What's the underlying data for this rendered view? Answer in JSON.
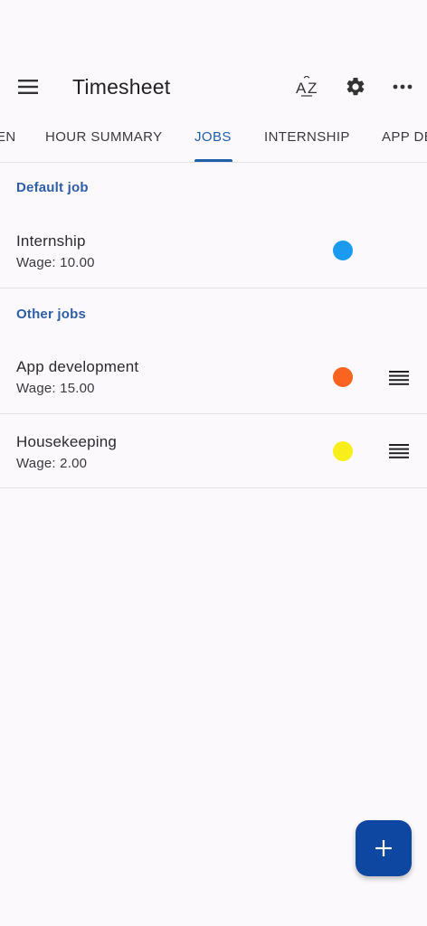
{
  "app_bar": {
    "title": "Timesheet",
    "icons": [
      "menu-icon",
      "sort-az-icon",
      "gear-icon",
      "more-horizontal-icon"
    ]
  },
  "tabs": [
    {
      "label": "EN",
      "active": false
    },
    {
      "label": "HOUR SUMMARY",
      "active": false
    },
    {
      "label": "JOBS",
      "active": true
    },
    {
      "label": "INTERNSHIP",
      "active": false
    },
    {
      "label": "APP DE",
      "active": false
    }
  ],
  "sections": {
    "default": {
      "header": "Default job",
      "jobs": [
        {
          "name": "Internship",
          "wage_label": "Wage: ",
          "wage": "10.00",
          "color": "#1a9bf0"
        }
      ]
    },
    "other": {
      "header": "Other jobs",
      "jobs": [
        {
          "name": "App development",
          "wage_label": "Wage: ",
          "wage": "15.00",
          "color": "#fb6420"
        },
        {
          "name": "Housekeeping",
          "wage_label": "Wage: ",
          "wage": "2.00",
          "color": "#f8ee19"
        }
      ]
    }
  },
  "colors": {
    "accent": "#1f5fa8",
    "fab": "#0d47a1",
    "background": "#fbf9fc"
  },
  "fab": {
    "icon": "plus-icon"
  }
}
